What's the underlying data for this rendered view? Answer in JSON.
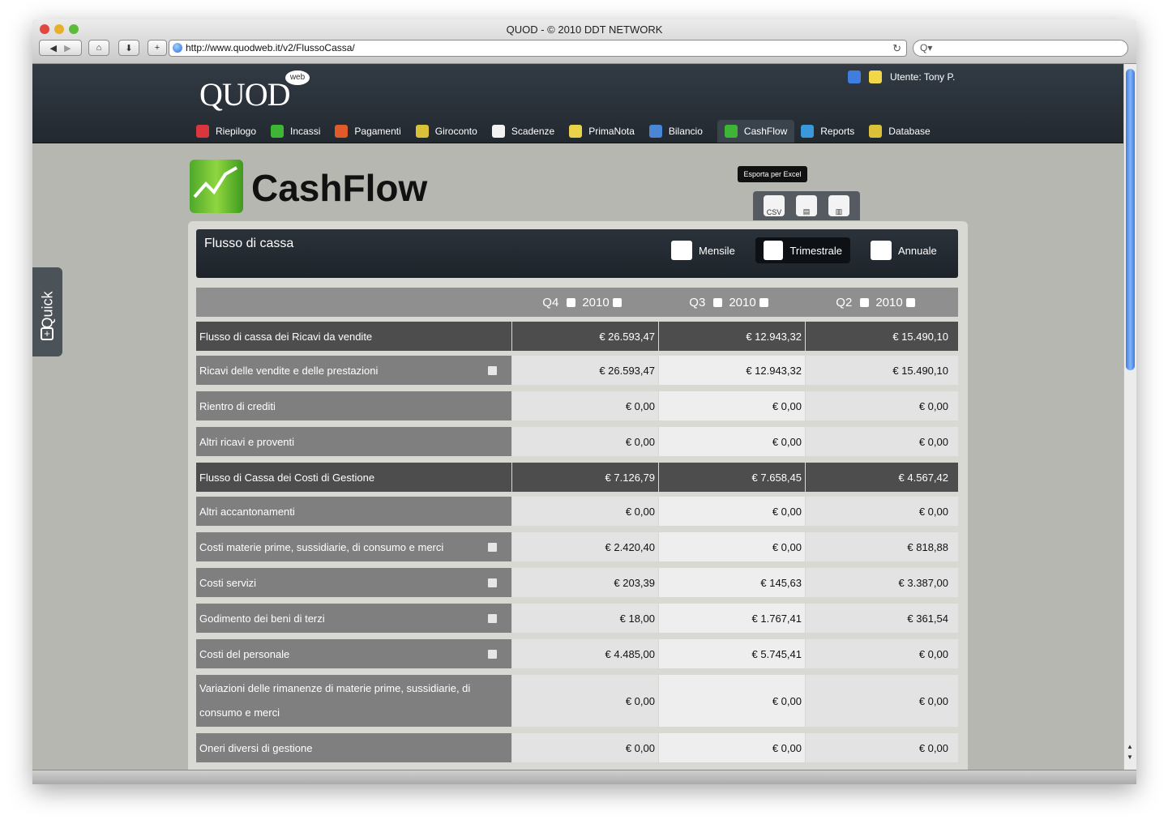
{
  "browser": {
    "title": "QUOD - © 2010 DDT NETWORK",
    "url": "http://www.quodweb.it/v2/FlussoCassa/",
    "search_placeholder": "Q▾"
  },
  "app": {
    "logo": "QUOD",
    "logo_badge": "web",
    "user": "Utente: Tony P.",
    "quick_label": "Quick"
  },
  "nav": [
    {
      "label": "Riepilogo",
      "color": "#d9363e"
    },
    {
      "label": "Incassi",
      "color": "#3fb535"
    },
    {
      "label": "Pagamenti",
      "color": "#e05a2b"
    },
    {
      "label": "Giroconto",
      "color": "#d9c13a"
    },
    {
      "label": "Scadenze",
      "color": "#f2f2f2"
    },
    {
      "label": "PrimaNota",
      "color": "#e8d34a"
    },
    {
      "label": "Bilancio",
      "color": "#4a86d6"
    },
    {
      "label": "CashFlow",
      "color": "#3fb535"
    },
    {
      "label": "Reports",
      "color": "#3a9ad9"
    },
    {
      "label": "Database",
      "color": "#d9c13a"
    }
  ],
  "page": {
    "title": "CashFlow",
    "tooltip": "Esporta per Excel",
    "export_buttons": [
      "CSV",
      "",
      ""
    ]
  },
  "panel": {
    "title": "Flusso di cassa",
    "periods": [
      "Mensile",
      "Trimestrale",
      "Annuale"
    ],
    "active_period": "Trimestrale"
  },
  "table": {
    "columns": [
      {
        "quarter": "Q4",
        "year": "2010"
      },
      {
        "quarter": "Q3",
        "year": "2010"
      },
      {
        "quarter": "Q2",
        "year": "2010"
      }
    ],
    "rows": [
      {
        "label": "Flusso di cassa dei Ricavi da vendite",
        "values": [
          "€  26.593,47",
          "€  12.943,32",
          "€  15.490,10"
        ],
        "section": true,
        "detail": false
      },
      {
        "label": "Ricavi delle vendite e delle prestazioni",
        "values": [
          "€  26.593,47",
          "€  12.943,32",
          "€  15.490,10"
        ],
        "section": false,
        "detail": true
      },
      {
        "label": "Rientro di crediti",
        "values": [
          "€  0,00",
          "€  0,00",
          "€  0,00"
        ],
        "section": false,
        "detail": false
      },
      {
        "label": "Altri ricavi e proventi",
        "values": [
          "€  0,00",
          "€  0,00",
          "€  0,00"
        ],
        "section": false,
        "detail": false
      },
      {
        "label": "Flusso di Cassa dei Costi di Gestione",
        "values": [
          "€  7.126,79",
          "€  7.658,45",
          "€  4.567,42"
        ],
        "section": true,
        "detail": false
      },
      {
        "label": "Altri accantonamenti",
        "values": [
          "€  0,00",
          "€  0,00",
          "€  0,00"
        ],
        "section": false,
        "detail": false
      },
      {
        "label": "Costi materie prime, sussidiarie, di consumo e merci",
        "values": [
          "€  2.420,40",
          "€  0,00",
          "€  818,88"
        ],
        "section": false,
        "detail": true
      },
      {
        "label": "Costi servizi",
        "values": [
          "€  203,39",
          "€  145,63",
          "€  3.387,00"
        ],
        "section": false,
        "detail": true
      },
      {
        "label": "Godimento dei beni di terzi",
        "values": [
          "€  18,00",
          "€  1.767,41",
          "€  361,54"
        ],
        "section": false,
        "detail": true
      },
      {
        "label": "Costi del personale",
        "values": [
          "€  4.485,00",
          "€  5.745,41",
          "€  0,00"
        ],
        "section": false,
        "detail": true
      },
      {
        "label": "Variazioni delle rimanenze di materie prime, sussidiarie, di consumo e merci",
        "values": [
          "€  0,00",
          "€  0,00",
          "€  0,00"
        ],
        "section": false,
        "detail": false
      },
      {
        "label": "Oneri diversi di gestione",
        "values": [
          "€  0,00",
          "€  0,00",
          "€  0,00"
        ],
        "section": false,
        "detail": false
      }
    ]
  }
}
